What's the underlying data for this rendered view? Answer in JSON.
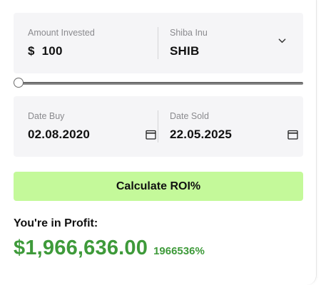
{
  "investment": {
    "amount_label": "Amount Invested",
    "currency_symbol": "$",
    "amount_value": "100",
    "coin_label": "Shiba Inu",
    "coin_value": "SHIB",
    "coin_icon": "chevron-down-icon"
  },
  "slider": {
    "level_fraction": 0.0
  },
  "dates": {
    "buy_label": "Date Buy",
    "buy_value": "02.08.2020",
    "sold_label": "Date Sold",
    "sold_value": "22.05.2025",
    "calendar_icon": "calendar-icon"
  },
  "actions": {
    "calculate_label": "Calculate ROI%"
  },
  "result": {
    "status_label": "You're in Profit:",
    "profit_amount": "$1,966,636.00",
    "profit_percent": "1966536%"
  },
  "colors": {
    "button_bg": "#c4f99a",
    "profit_green": "#3e9a3a",
    "panel_bg": "#f5f5f7"
  }
}
